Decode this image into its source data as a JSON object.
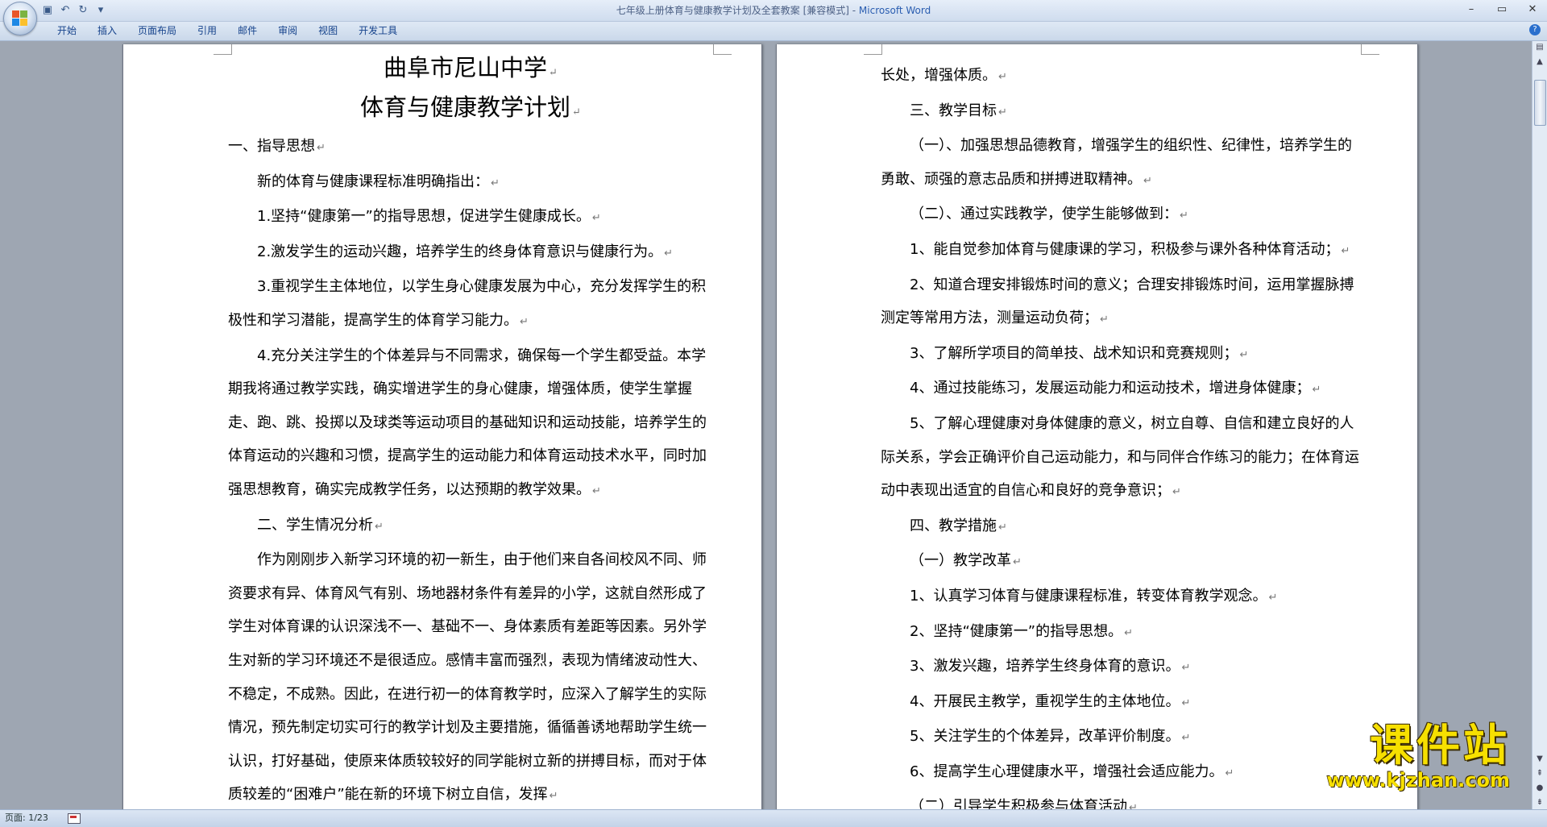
{
  "window": {
    "title": "七年级上册体育与健康教学计划及全套教案 [兼容模式] - ",
    "app_name": "Microsoft Word",
    "qat_icons": [
      "save-icon",
      "undo-icon",
      "redo-icon",
      "customize-icon"
    ]
  },
  "ribbon": {
    "tabs": [
      "开始",
      "插入",
      "页面布局",
      "引用",
      "邮件",
      "审阅",
      "视图",
      "开发工具"
    ]
  },
  "left_page": {
    "title1": "曲阜市尼山中学",
    "title2": "体育与健康教学计划",
    "paragraphs": [
      "一、指导思想",
      "新的体育与健康课程标准明确指出：",
      "1.坚持“健康第一”的指导思想，促进学生健康成长。",
      "2.激发学生的运动兴趣，培养学生的终身体育意识与健康行为。",
      "3.重视学生主体地位，以学生身心健康发展为中心，充分发挥学生的积极性和学习潜能，提高学生的体育学习能力。",
      "4.充分关注学生的个体差异与不同需求，确保每一个学生都受益。本学期我将通过教学实践，确实增进学生的身心健康，增强体质，使学生掌握走、跑、跳、投掷以及球类等运动项目的基础知识和运动技能，培养学生的体育运动的兴趣和习惯，提高学生的运动能力和体育运动技术水平，同时加强思想教育，确实完成教学任务，以达预期的教学效果。",
      "二、学生情况分析",
      "作为刚刚步入新学习环境的初一新生，由于他们来自各间校风不同、师资要求有异、体育风气有别、场地器材条件有差异的小学，这就自然形成了学生对体育课的认识深浅不一、基础不一、身体素质有差距等因素。另外学生对新的学习环境还不是很适应。感情丰富而强烈，表现为情绪波动性大、不稳定，不成熟。因此，在进行初一的体育教学时，应深入了解学生的实际情况，预先制定切实可行的教学计划及主要措施，循循善诱地帮助学生统一认识，打好基础，使原来体质较较好的同学能树立新的拼搏目标，而对于体质较差的“困难户”能在新的环境下树立自信，发挥"
    ]
  },
  "right_page": {
    "paragraphs": [
      "长处，增强体质。",
      "三、教学目标",
      "（一）、加强思想品德教育，增强学生的组织性、纪律性，培养学生的勇敢、顽强的意志品质和拼搏进取精神。",
      "（二）、通过实践教学，使学生能够做到：",
      "1、能自觉参加体育与健康课的学习，积极参与课外各种体育活动；",
      "2、知道合理安排锻炼时间的意义；合理安排锻炼时间，运用掌握脉搏测定等常用方法，测量运动负荷；",
      "3、了解所学项目的简单技、战术知识和竞赛规则；",
      "4、通过技能练习，发展运动能力和运动技术，增进身体健康；",
      "5、了解心理健康对身体健康的意义，树立自尊、自信和建立良好的人际关系，学会正确评价自己运动能力，和与同伴合作练习的能力；在体育运动中表现出适宜的自信心和良好的竞争意识；",
      "四、教学措施",
      "（一）教学改革",
      "1、认真学习体育与健康课程标准，转变体育教学观念。",
      "2、坚持“健康第一”的指导思想。",
      "3、激发兴趣，培养学生终身体育的意识。",
      "4、开展民主教学，重视学生的主体地位。",
      "5、关注学生的个体差异，改革评价制度。",
      "6、提高学生心理健康水平，增强社会适应能力。",
      "（二）引导学生积极参与体育活动"
    ]
  },
  "paragraph_mark": "↵",
  "status": {
    "page": "页面: 1/23"
  },
  "watermark": {
    "title": "课件站",
    "url": "www.kjzhan.com"
  }
}
